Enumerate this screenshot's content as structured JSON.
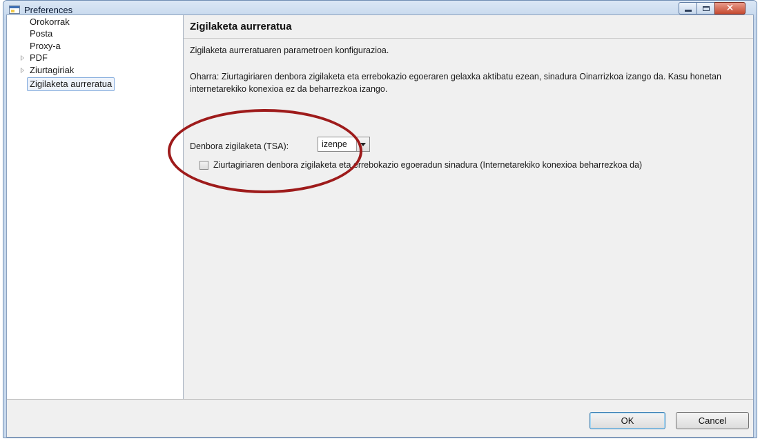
{
  "window": {
    "title": "Preferences"
  },
  "tree": {
    "items": [
      {
        "label": "Orokorrak",
        "expandable": false
      },
      {
        "label": "Posta",
        "expandable": false
      },
      {
        "label": "Proxy-a",
        "expandable": false
      },
      {
        "label": "PDF",
        "expandable": true
      },
      {
        "label": "Ziurtagiriak",
        "expandable": true
      },
      {
        "label": "Zigilaketa aurreratua",
        "expandable": false,
        "selected": true
      }
    ]
  },
  "page": {
    "title": "Zigilaketa aurreratua",
    "description": "Zigilaketa aurreratuaren parametroen konfigurazioa.",
    "note": "Oharra: Ziurtagiriaren denbora zigilaketa eta errebokazio egoeraren gelaxka aktibatu ezean, sinadura Oinarrizkoa izango da. Kasu honetan internetarekiko konexioa ez da beharrezkoa izango.",
    "tsa": {
      "label": "Denbora zigilaketa (TSA):",
      "selected": "izenpe"
    },
    "checkbox": {
      "label": "Ziurtagiriaren denbora zigilaketa eta errebokazio egoeradun sinadura (Internetarekiko konexioa beharrezkoa da)",
      "checked": false
    }
  },
  "buttons": {
    "ok": "OK",
    "cancel": "Cancel"
  },
  "colors": {
    "highlight": "#9e1b1b",
    "title_bar": "#c8d9ed",
    "close_button": "#c54a30"
  }
}
